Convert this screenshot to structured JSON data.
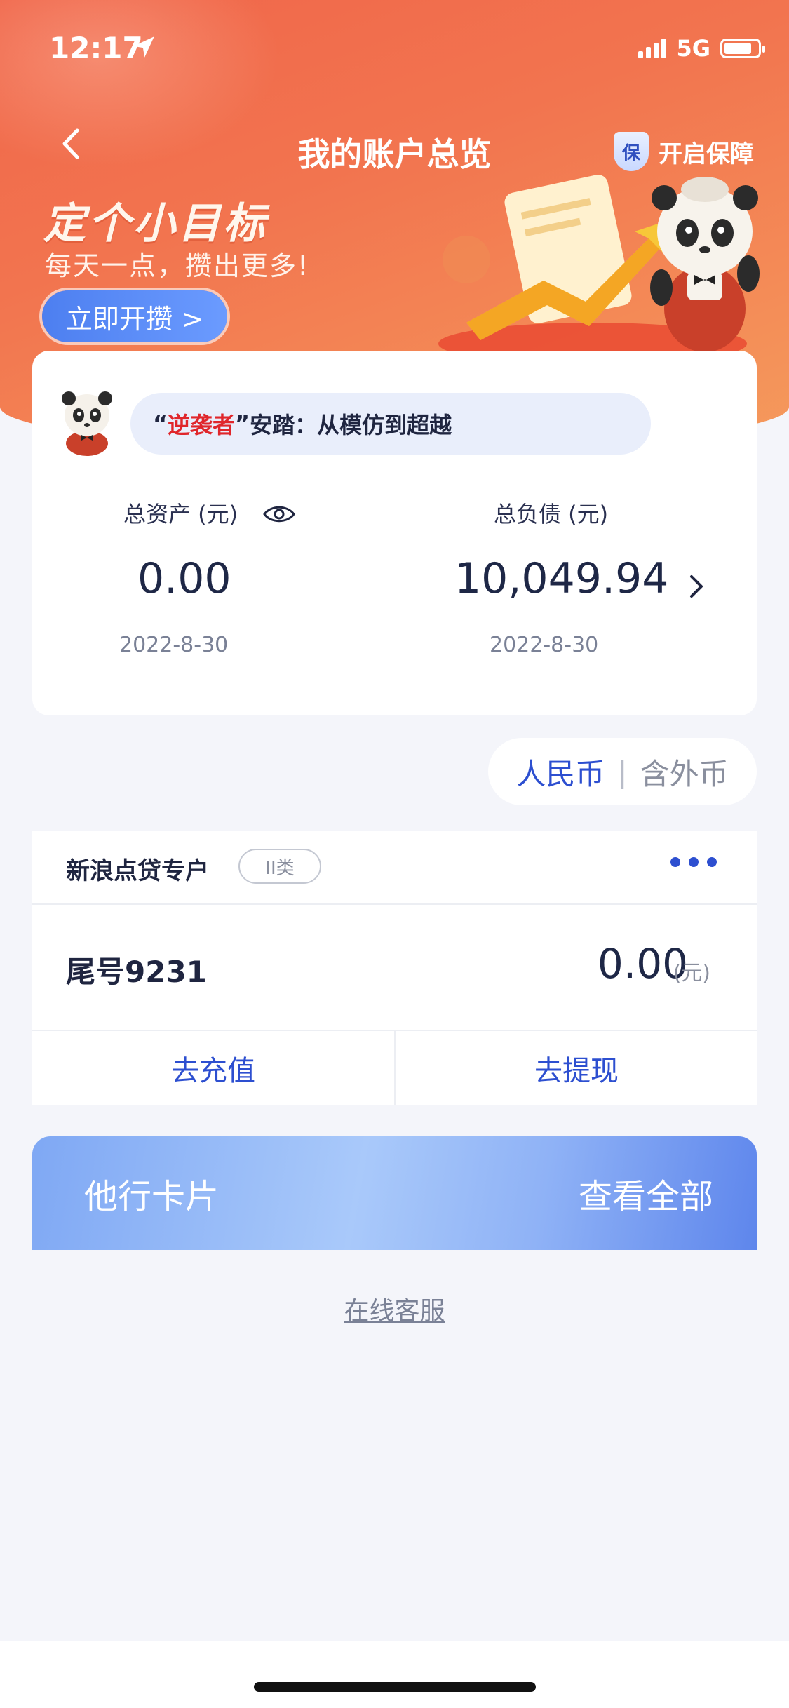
{
  "status_bar": {
    "time": "12:17",
    "network": "5G"
  },
  "header": {
    "title": "我的账户总览",
    "protect_label": "开启保障",
    "shield_char": "保"
  },
  "promo": {
    "title": "定个小目标",
    "subtitle": "每天一点，攒出更多!",
    "button_label": "立即开攒 >"
  },
  "news": {
    "quote_open": "“",
    "highlight": "逆袭者",
    "quote_close": "”",
    "rest": "安踏：从模仿到超越"
  },
  "summary": {
    "total_assets_label": "总资产 (元)",
    "total_assets_value": "0.00",
    "total_assets_date": "2022-8-30",
    "total_liabilities_label": "总负债 (元)",
    "total_liabilities_value": "10,049.94",
    "total_liabilities_date": "2022-8-30"
  },
  "currency_toggle": {
    "active": "人民币",
    "separator": "|",
    "inactive": "含外币"
  },
  "account": {
    "name": "新浪点贷专户",
    "tag": "II类",
    "tail": "尾号9231",
    "balance": "0.00",
    "unit": "(元)",
    "recharge_label": "去充值",
    "withdraw_label": "去提现"
  },
  "other_cards": {
    "label": "他行卡片",
    "view_all": "查看全部"
  },
  "service": {
    "label": "在线客服"
  },
  "colors": {
    "accent_blue": "#2d4fd0",
    "header_orange": "#f0664a",
    "highlight_red": "#e0262b"
  }
}
